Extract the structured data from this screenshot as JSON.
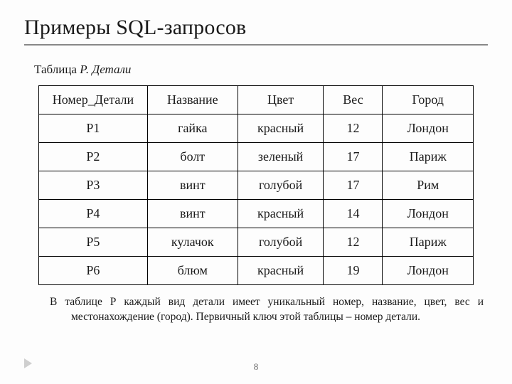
{
  "title": "Примеры SQL-запросов",
  "subtitle_prefix": "Таблица ",
  "subtitle_table": "Р. Детали",
  "table": {
    "headers": [
      "Номер_Детали",
      "Название",
      "Цвет",
      "Вес",
      "Город"
    ],
    "rows": [
      [
        "Р1",
        "гайка",
        "красный",
        "12",
        "Лондон"
      ],
      [
        "Р2",
        "болт",
        "зеленый",
        "17",
        "Париж"
      ],
      [
        "Р3",
        "винт",
        "голубой",
        "17",
        "Рим"
      ],
      [
        "Р4",
        "винт",
        "красный",
        "14",
        "Лондон"
      ],
      [
        "Р5",
        "кулачок",
        "голубой",
        "12",
        "Париж"
      ],
      [
        "Р6",
        "блюм",
        "красный",
        "19",
        "Лондон"
      ]
    ]
  },
  "caption": "В таблице Р каждый вид детали имеет  уникальный номер, название, цвет, вес и местонахождение (город). Первичный ключ этой таблицы – номер детали.",
  "page_number": "8"
}
